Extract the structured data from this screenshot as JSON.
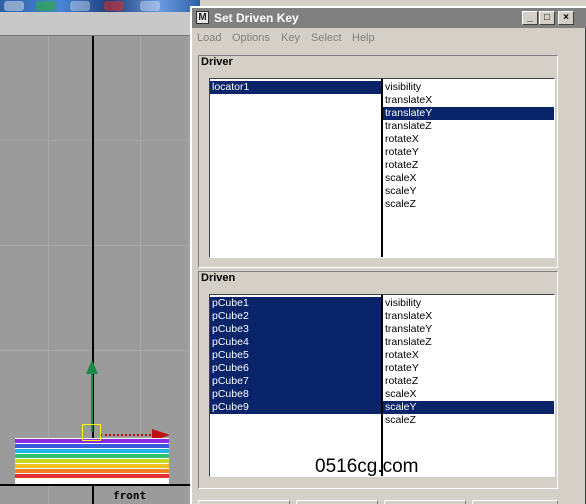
{
  "dialog": {
    "title": "Set Driven Key",
    "icon_letter": "M",
    "controls": {
      "minimize": "_",
      "maximize": "□",
      "close": "×"
    }
  },
  "menu": [
    "Load",
    "Options",
    "Key",
    "Select",
    "Help"
  ],
  "driver": {
    "label": "Driver",
    "objects": [
      {
        "name": "locator1",
        "selected": true
      }
    ],
    "attributes": [
      {
        "name": "visibility",
        "selected": false
      },
      {
        "name": "translateX",
        "selected": false
      },
      {
        "name": "translateY",
        "selected": true
      },
      {
        "name": "translateZ",
        "selected": false
      },
      {
        "name": "rotateX",
        "selected": false
      },
      {
        "name": "rotateY",
        "selected": false
      },
      {
        "name": "rotateZ",
        "selected": false
      },
      {
        "name": "scaleX",
        "selected": false
      },
      {
        "name": "scaleY",
        "selected": false
      },
      {
        "name": "scaleZ",
        "selected": false
      }
    ]
  },
  "driven": {
    "label": "Driven",
    "objects": [
      {
        "name": "pCube1",
        "selected": true
      },
      {
        "name": "pCube2",
        "selected": true
      },
      {
        "name": "pCube3",
        "selected": true
      },
      {
        "name": "pCube4",
        "selected": true
      },
      {
        "name": "pCube5",
        "selected": true
      },
      {
        "name": "pCube6",
        "selected": true
      },
      {
        "name": "pCube7",
        "selected": true
      },
      {
        "name": "pCube8",
        "selected": true
      },
      {
        "name": "pCube9",
        "selected": true
      }
    ],
    "attributes": [
      {
        "name": "visibility",
        "selected": false
      },
      {
        "name": "translateX",
        "selected": false
      },
      {
        "name": "translateY",
        "selected": false
      },
      {
        "name": "translateZ",
        "selected": false
      },
      {
        "name": "rotateX",
        "selected": false
      },
      {
        "name": "rotateY",
        "selected": false
      },
      {
        "name": "rotateZ",
        "selected": false
      },
      {
        "name": "scaleX",
        "selected": false
      },
      {
        "name": "scaleY",
        "selected": true
      },
      {
        "name": "scaleZ",
        "selected": false
      }
    ]
  },
  "viewport": {
    "camera_label": "front",
    "cube_colors": [
      "#8a2be2",
      "#3b5bdb",
      "#20b2e0",
      "#2fbf71",
      "#c8d820",
      "#f0c020",
      "#f08020",
      "#e03030"
    ]
  },
  "watermark": "0516cg.com",
  "colors": {
    "selection": "#0a246a",
    "title_inactive": "#808080"
  }
}
